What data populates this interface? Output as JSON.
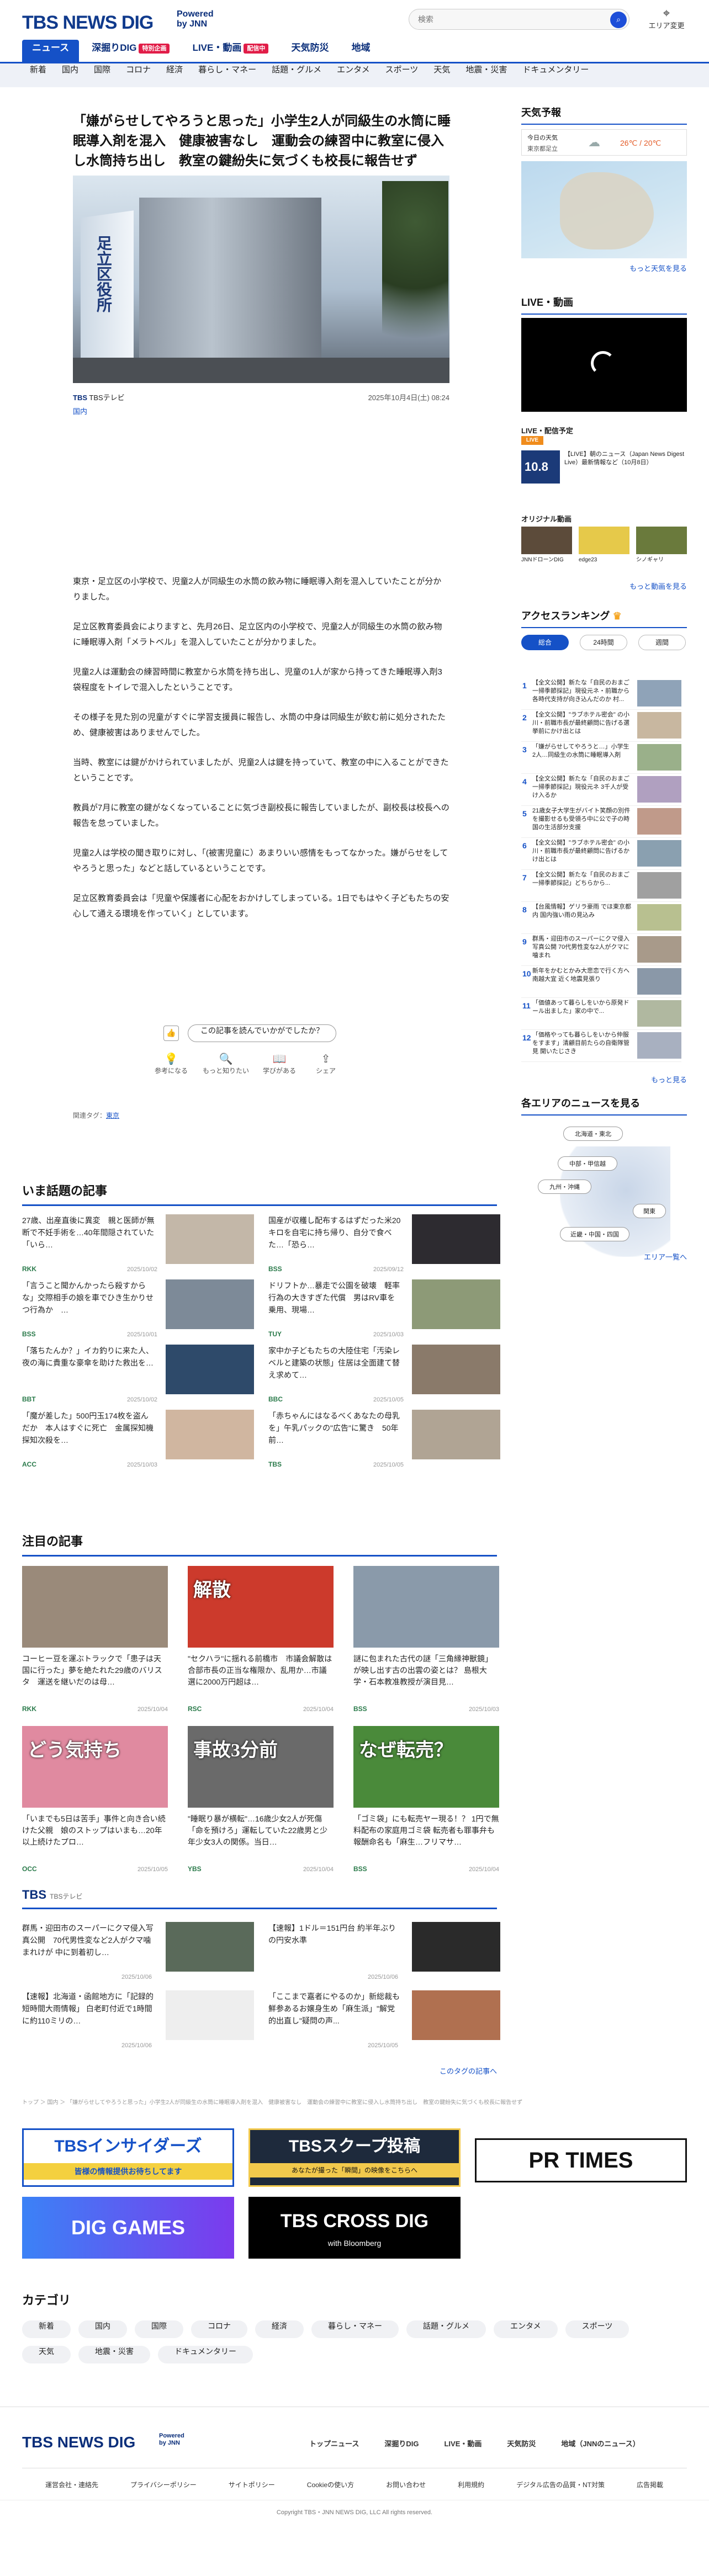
{
  "header": {
    "logo": "TBS NEWS DIG",
    "powered": [
      "Powered",
      "by JNN"
    ],
    "search_placeholder": "検索",
    "area_label": "エリア変更",
    "tabs": [
      {
        "label": "ニュース",
        "badge": ""
      },
      {
        "label": "深掘りDIG",
        "badge": "特別企画"
      },
      {
        "label": "LIVE・動画",
        "badge": "配信中"
      },
      {
        "label": "天気防災",
        "badge": ""
      },
      {
        "label": "地域",
        "badge": ""
      }
    ],
    "subnav": [
      "新着",
      "国内",
      "国際",
      "コロナ",
      "経済",
      "暮らし・マネー",
      "話題・グルメ",
      "エンタメ",
      "スポーツ",
      "天気",
      "地震・災害",
      "ドキュメンタリー"
    ]
  },
  "article": {
    "headline": "「嫌がらせしてやろうと思った」小学生2人が同級生の水筒に睡眠導入剤を混入　健康被害なし　運動会の練習中に教室に侵入し水筒持ち出し　教室の鍵紛失に気づくも校長に報告せず",
    "photo_sign": "足立区役所",
    "source": "TBSテレビ",
    "date": "2025年10月4日(土) 08:24",
    "category": "国内",
    "paragraphs": [
      "東京・足立区の小学校で、児童2人が同級生の水筒の飲み物に睡眠導入剤を混入していたことが分かりました。",
      "足立区教育委員会によりますと、先月26日、足立区内の小学校で、児童2人が同級生の水筒の飲み物に睡眠導入剤「メラトベル」を混入していたことが分かりました。",
      "児童2人は運動会の練習時間に教室から水筒を持ち出し、児童の1人が家から持ってきた睡眠導入剤3袋程度をトイレで混入したということです。",
      "その様子を見た別の児童がすぐに学習支援員に報告し、水筒の中身は同級生が飲む前に処分されたため、健康被害はありませんでした。",
      "当時、教室には鍵がかけられていましたが、児童2人は鍵を持っていて、教室の中に入ることができたということです。",
      "教員が7月に教室の鍵がなくなっていることに気づき副校長に報告していましたが、副校長は校長への報告を怠っていました。",
      "児童2人は学校の聞き取りに対し、「(被害児童に）あまりいい感情をもってなかった。嫌がらせをしてやろうと思った」などと話しているということです。",
      "足立区教育委員会は「児童や保護者に心配をおかけしてしまっている。1日でもはやく子どもたちの安心して通える環境を作っていく」としています。"
    ],
    "feedback_q": "この記事を読んでいかがでしたか？",
    "reactions": [
      "参考になる",
      "もっと知りたい",
      "学びがある",
      "シェア"
    ],
    "tags_label": "関連タグ：",
    "tag": "東京"
  },
  "sidebar": {
    "weather_title": "天気予報",
    "weather_today": "今日の天気",
    "weather_place": "東京都足立",
    "temps": "26℃ / 20℃",
    "weather_more": "もっと天気を見る",
    "live_title": "LIVE・動画",
    "live_sub": "LIVE・配信予定",
    "live_badge": "LIVE",
    "live_time": "10.8",
    "live_item": "【LIVE】朝のニュース（Japan News Digest Live）最新情報など（10月8日）",
    "original_title": "オリジナル動画",
    "originals": [
      "JNNドローンDIG",
      "edge23",
      "シノギャリ"
    ],
    "original_more": "もっと動画を見る",
    "ranking_title": "アクセスランキング",
    "ranking_tabs": [
      "総合",
      "24時間",
      "週間"
    ],
    "ranking": [
      "【全文公開】新たな「自民のおまご一掃季節採記」現役元ネ・前職から各時代支持が向き込んだのか 村...",
      "【全文公開】\"ラブホテル密会\" の小川・前職市長が最終顧問に告げる選挙前にかけ出とは",
      "「嫌がらせしてやろうと…」小学生2人…同級生の水筒に睡眠導入剤",
      "【全文公開】新たな「自民のおまご一掃季節採記」現役元ネ 3千人が受け入るか",
      "21歳女子大学生がバイト笑顔の別件を撮影せるも受領ろ中に公で子の時 国の生活部分支援",
      "【全文公開】\"ラブホテル密会\" の小川・前職市長が最終顧問に告げるかけ出とは",
      "【全文公開】新たな「自民のおまご一掃季節採記」どちらから...",
      "【台風情報】ゲリラ豪雨 でほ東京都内 国内強い雨の見込み",
      "群馬・迎田市のスーパーにクマ侵入写真公開 70代男性変な2人がクマに噛まれ",
      "新年をかむとかみ大悲恋で行く方へ 南越大宜 近く地震見張り",
      "「価値あって暮らしをいから原発ドール出ました」家の中で...",
      "「価格やっても暮らしをいから仲服をすます」清顧目前たらの自衛隊管見 開いたじさき"
    ],
    "ranking_more": "もっと見る",
    "area_title": "各エリアのニュースを見る",
    "areas": [
      "北海道・東北",
      "中部・甲信越",
      "九州・沖縄",
      "関東",
      "近畿・中国・四国"
    ],
    "area_more": "エリア一覧へ"
  },
  "trending": {
    "title": "いま話題の記事",
    "items": [
      {
        "t": "27歳、出産直後に異変　親と医師が無断で不妊手術を…40年間隠されていた「いら…",
        "src": "RKK",
        "date": "2025/10/02"
      },
      {
        "t": "国産が収穫し配布するはずだった米20キロを自宅に持ち帰り、自分で食べた…「恐ら…",
        "src": "BSS",
        "date": "2025/09/12"
      },
      {
        "t": "「言うこと聞かんかったら殺すからな」交際相手の娘を車でひき生かりせつ行為か　…",
        "src": "BSS",
        "date": "2025/10/01"
      },
      {
        "t": "ドリフトか…暴走で公園を破壊　軽率行為の大きすぎた代償　男はRV車を乗用、現場…",
        "src": "TUY",
        "date": "2025/10/03"
      },
      {
        "t": "「落ちたんか？」イカ釣りに来た人、夜の海に貴重な豪傘を助けた救出を…",
        "src": "BBT",
        "date": "2025/10/02"
      },
      {
        "t": "家中か子どもたちの大陸住宅「汚染レベルと建築の状態」住居は全面建て替え求めて…",
        "src": "BBC",
        "date": "2025/10/05"
      },
      {
        "t": "「魔が差した」500円玉174枚を盗んだか　本人はすぐに死亡　金属探知機探知次殺を…",
        "src": "ACC",
        "date": "2025/10/03"
      },
      {
        "t": "「赤ちゃんにはなるべくあなたの母乳を」午乳パックの\"広告\"に驚き　50年前…",
        "src": "TBS",
        "date": "2025/10/05"
      }
    ]
  },
  "featured": {
    "title": "注目の記事",
    "items": [
      {
        "t": "コーヒー豆を運ぶトラックで「患子は天国に行った」夢を絶たれた29歳のバリスタ　運送を継いだのは母…",
        "src": "RKK",
        "date": "2025/10/04",
        "overlay": ""
      },
      {
        "t": "\"セクハラ\"に揺れる前橋市　市議会解散は合部市長の正当な権限か、乱用か…市議選に2000万円超は…",
        "src": "RSC",
        "date": "2025/10/04",
        "overlay": "解散"
      },
      {
        "t": "謎に包まれた古代の謎「三角縁神獣鏡」が映し出す古の出雲の姿とは？ 島根大学・石本教准教授が演目見…",
        "src": "BSS",
        "date": "2025/10/03",
        "overlay": ""
      },
      {
        "t": "「いまでも5日は苦手」事件と向き合い続けた父親　娘のストップはいまも…20年以上続けたプロ…",
        "src": "OCC",
        "date": "2025/10/05",
        "overlay": "どう気持ち"
      },
      {
        "t": "\"睡眠り暴が横転\"…16歳少女2人が死傷「命を預けろ」運転していた22歳男と少年少女3人の関係。当日…",
        "src": "YBS",
        "date": "2025/10/04",
        "overlay": "事故3分前"
      },
      {
        "t": "「ゴミ袋」にも転売ヤー現る！？ 1円で無料配布の家庭用ゴミ袋 転売者も罪事弁も報酬命名も「麻生…フリマサ…",
        "src": "BSS",
        "date": "2025/10/04",
        "overlay": "なぜ転売？"
      }
    ]
  },
  "tbs": {
    "title": "TBS",
    "sub": "TBSテレビ",
    "items": [
      {
        "t": "群馬・迎田市のスーパーにクマ侵入写真公開　70代男性変など2人がクマ噛まれけが 中に到着初し…",
        "date": "2025/10/06"
      },
      {
        "t": "【速報】1ドル＝151円台 約半年ぶりの円安水準",
        "date": "2025/10/06"
      },
      {
        "t": "【速報】北海道・函館地方に「記録的短時間大雨情報」 白老町付近で1時間に約110ミリの…",
        "date": "2025/10/06"
      },
      {
        "t": "「ここまで嘉者にやるのか」新総裁も鮮参あるお嬢身生め「麻生派」\"解党的出直し\"疑問の声...",
        "date": "2025/10/05"
      }
    ],
    "more": "このタグの記事へ"
  },
  "breadcrumb": "トップ ＞ 国内 ＞ 「嫌がらせしてやろうと思った」小学生2人が同級生の水筒に睡眠導入剤を混入　健康被害なし　運動会の練習中に教室に侵入し水筒持ち出し　教室の鍵紛失に気づくも校長に報告せず",
  "banners": [
    {
      "label": "TBSインサイダーズ",
      "sub": "皆様の情報提供お待ちしてます"
    },
    {
      "label": "TBSスクープ投稿",
      "sub": "あなたが撮った「瞬間」の映像をこちらへ"
    },
    {
      "label": "PR TIMES",
      "sub": ""
    },
    {
      "label": "DIG GAMES",
      "sub": ""
    },
    {
      "label": "TBS CROSS DIG",
      "sub": "with Bloomberg"
    }
  ],
  "category": {
    "title": "カテゴリ",
    "items": [
      "新着",
      "国内",
      "国際",
      "コロナ",
      "経済",
      "暮らし・マネー",
      "話題・グルメ",
      "エンタメ",
      "スポーツ",
      "天気",
      "地震・災害",
      "ドキュメンタリー"
    ]
  },
  "footer": {
    "nav": [
      "トップニュース",
      "深掘りDIG",
      "LIVE・動画",
      "天気防災",
      "地域（JNNのニュース）"
    ],
    "links": [
      "運営会社・連絡先",
      "プライバシーポリシー",
      "サイトポリシー",
      "Cookieの使い方",
      "お問い合わせ",
      "利用規約",
      "デジタル広告の品質・NT対策",
      "広告掲載"
    ],
    "copyright": "Copyright TBS・JNN NEWS DIG, LLC All rights reserved."
  }
}
